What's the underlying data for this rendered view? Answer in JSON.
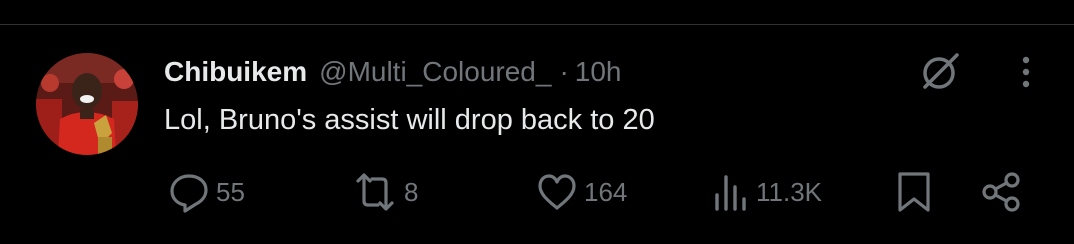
{
  "tweet": {
    "author_name": "Chibuikem",
    "handle": "@Multi_Coloured_",
    "separator": "·",
    "time": "10h",
    "text": "Lol, Bruno's assist will drop back to 20"
  },
  "actions": {
    "replies": "55",
    "reposts": "8",
    "likes": "164",
    "views": "11.3K"
  },
  "icons": {
    "reply": "reply-icon",
    "repost": "repost-icon",
    "like": "heart-icon",
    "views": "views-icon",
    "bookmark": "bookmark-icon",
    "share": "share-icon",
    "grok": "grok-icon",
    "more": "more-icon"
  },
  "colors": {
    "background": "#000000",
    "primary_text": "#e7e9ea",
    "secondary_text": "#71767b",
    "divider": "#2f3336"
  }
}
